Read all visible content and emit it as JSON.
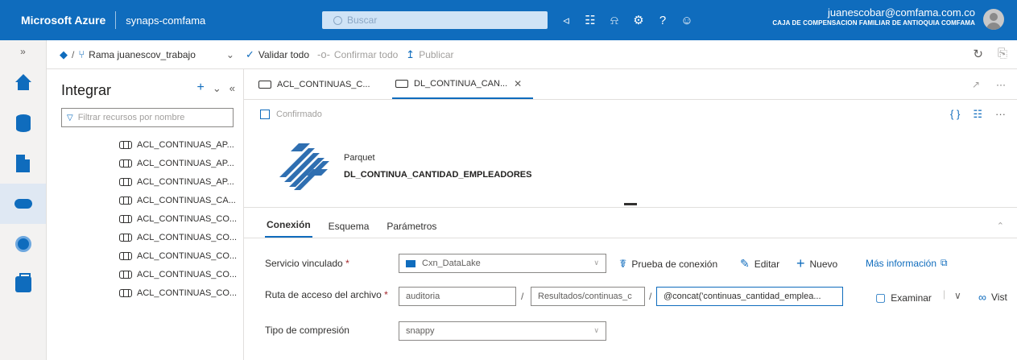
{
  "topbar": {
    "brand": "Microsoft Azure",
    "workspace": "synaps-comfama",
    "search_placeholder": "Buscar",
    "user_email": "juanescobar@comfama.com.co",
    "user_org": "CAJA DE COMPENSACION FAMILIAR DE ANTIOQUIA COMFAMA"
  },
  "rail": {
    "expand": "»",
    "items": [
      "home-icon",
      "data-icon",
      "develop-icon",
      "integrate-icon",
      "monitor-icon",
      "manage-icon"
    ],
    "active_index": 3
  },
  "toolbar": {
    "branch_label": "Rama juanescov_trabajo",
    "validate_all": "Validar todo",
    "commit_all": "Confirmar todo",
    "publish": "Publicar"
  },
  "pane": {
    "title": "Integrar",
    "filter_placeholder": "Filtrar recursos por nombre",
    "items": [
      "ACL_CONTINUAS_AP...",
      "ACL_CONTINUAS_AP...",
      "ACL_CONTINUAS_AP...",
      "ACL_CONTINUAS_CA...",
      "ACL_CONTINUAS_CO...",
      "ACL_CONTINUAS_CO...",
      "ACL_CONTINUAS_CO...",
      "ACL_CONTINUAS_CO...",
      "ACL_CONTINUAS_CO..."
    ]
  },
  "tabs": [
    {
      "label": "ACL_CONTINUAS_C...",
      "active": false
    },
    {
      "label": "DL_CONTINUA_CAN...",
      "active": true
    }
  ],
  "status": {
    "label": "Confirmado"
  },
  "dataset": {
    "kind": "Parquet",
    "name": "DL_CONTINUA_CANTIDAD_EMPLEADORES"
  },
  "config_tabs": [
    "Conexión",
    "Esquema",
    "Parámetros"
  ],
  "form": {
    "linked_service_label": "Servicio vinculado",
    "linked_service_value": "Cxn_DataLake",
    "test_connection": "Prueba de conexión",
    "edit": "Editar",
    "new": "Nuevo",
    "more_info": "Más información",
    "file_path_label": "Ruta de acceso del archivo",
    "path_container": "auditoria",
    "path_directory": "Resultados/continuas_c",
    "path_file": "@concat('continuas_cantidad_emplea...",
    "browse": "Examinar",
    "preview": "Vist",
    "compression_label": "Tipo de compresión",
    "compression_value": "snappy"
  }
}
